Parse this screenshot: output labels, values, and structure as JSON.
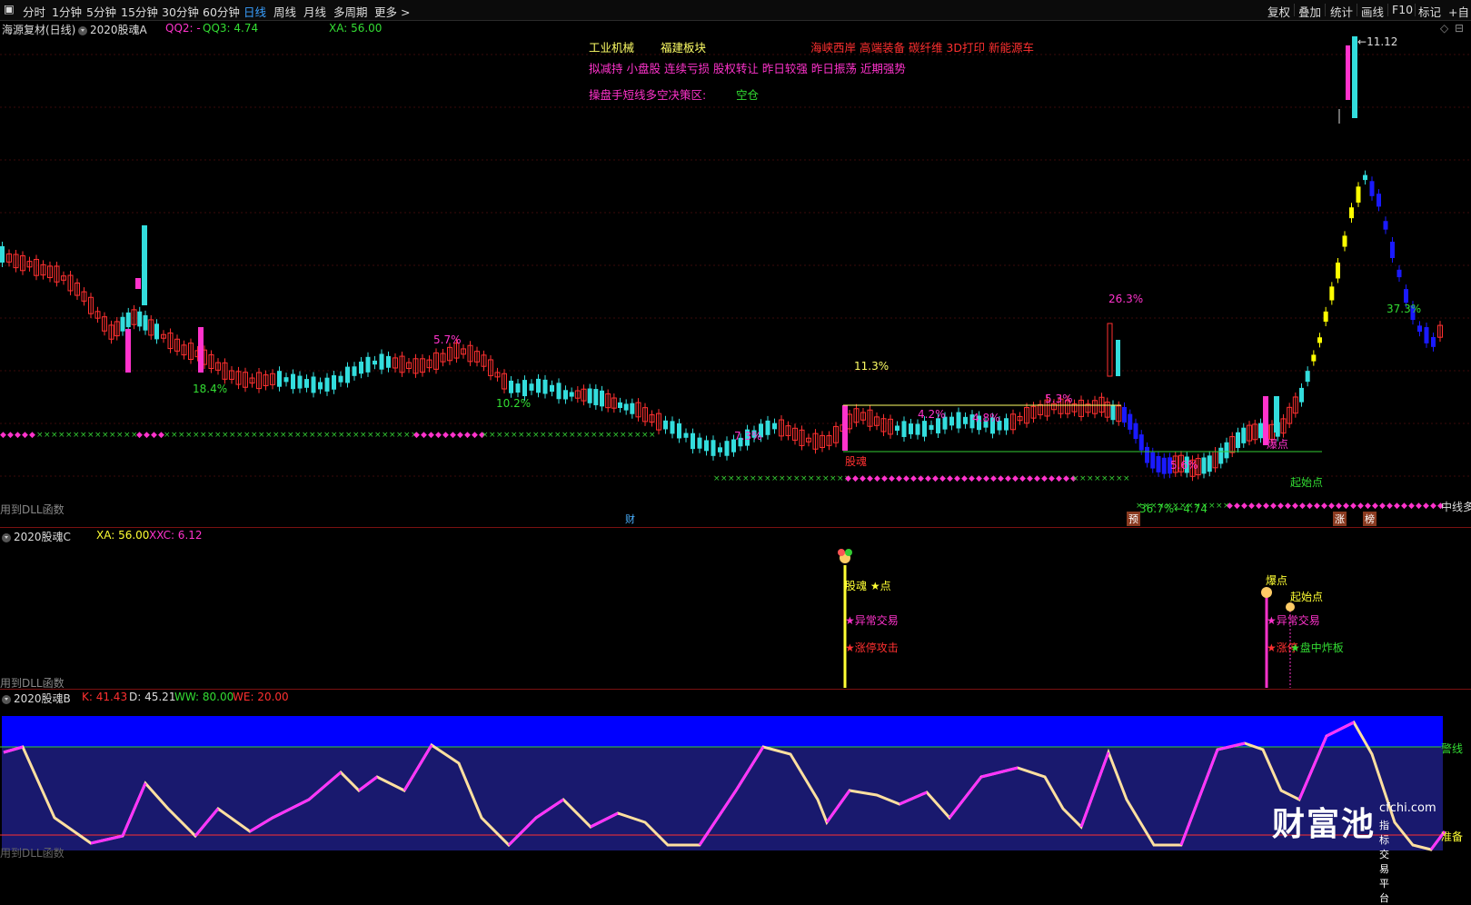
{
  "toolbar": {
    "periods": [
      "分时",
      "1分钟",
      "5分钟",
      "15分钟",
      "30分钟",
      "60分钟",
      "日线",
      "周线",
      "月线",
      "多周期",
      "更多 >"
    ],
    "active": "日线",
    "right": [
      "复权",
      "叠加",
      "统计",
      "画线",
      "F10",
      "标记",
      "+自"
    ]
  },
  "main": {
    "stock": "海源复材(日线)",
    "indicator": "2020股魂A",
    "qq2": "QQ2: -",
    "qq3": "QQ3: 4.74",
    "xa": "XA: 56.00",
    "tags": {
      "industry": "工业机械",
      "region": "福建板块",
      "concepts": "海峡西岸 高端装备 碳纤维 3D打印 新能源车",
      "notes": "拟减持 小盘股 连续亏损 股权转让 昨日较强 昨日振荡 近期强势",
      "decision_label": "操盘手短线多空决策区:",
      "decision_value": "空仓"
    },
    "price_labels": {
      "high": "11.12",
      "low": "4.74",
      "p263": "26.3%",
      "p113": "11.3%",
      "p57": "5.7%",
      "p184": "18.4%",
      "p102": "10.2%",
      "p73": "7.3%",
      "p42": "4.2%",
      "p48": "4.8%",
      "p53": "5.3%",
      "p56": "5.6%",
      "p373": "37.3%",
      "p367": "36.7%"
    },
    "markers": {
      "guhun": "股魂",
      "baodian": "爆点",
      "qishidian": "起始点",
      "zhongxian": "中线多",
      "dll": "用到DLL函数",
      "cai": "财",
      "yu": "预",
      "zhang": "涨",
      "bang": "榜"
    }
  },
  "panelC": {
    "indicator": "2020股魂C",
    "xa": "XA: 56.00",
    "xxc": "XXC: 6.12",
    "labels": {
      "guhun_star": "股魂 ★点",
      "abnormal": "★异常交易",
      "limit_attack": "★涨停攻击",
      "baodian": "爆点",
      "qishidian": "起始点",
      "abnormal2": "★异常交易",
      "limit2": "★涨停",
      "intraday": "★盘中炸板",
      "dll": "用到DLL函数"
    }
  },
  "panelB": {
    "indicator": "2020股魂B",
    "k": "K: 41.43",
    "d": "D: 45.21",
    "ww": "WW: 80.00",
    "we": "WE: 20.00",
    "warn": "警线",
    "ready": "准备",
    "dll": "用到DLL函数"
  },
  "watermark": {
    "brand": "财富池",
    "domain": "cfchi.com",
    "tagline": "指标交易平台"
  },
  "chart_data": {
    "type": "candlestick",
    "note_colors": {
      "up_bull": "#ff3030",
      "down": "#33dddd",
      "yellow": "#ffff00",
      "blue": "#0000ff",
      "magenta": "#ff33cc"
    },
    "price_high": 11.12,
    "price_low": 4.74
  },
  "colors": {
    "up": "#ff3030",
    "down": "#33dddd",
    "yellow": "#ffff00",
    "blue": "#1a1aff",
    "magenta": "#ff33cc",
    "green": "#33cc33"
  }
}
